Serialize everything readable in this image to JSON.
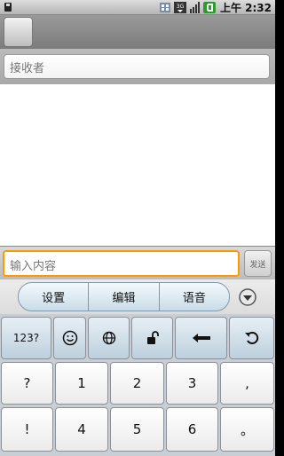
{
  "status_bar": {
    "time": "上午 2:32",
    "icons": [
      "sim-card-icon",
      "network-3g-icon",
      "signal-strength-icon",
      "battery-icon"
    ]
  },
  "recipients": {
    "placeholder": "接收者"
  },
  "compose": {
    "placeholder": "输入内容",
    "send_label": "发送"
  },
  "ime_toolbar": {
    "items": [
      "设置",
      "编辑",
      "语音"
    ],
    "more_icon": "chevron-down-circle-icon"
  },
  "keyboard": {
    "row1": {
      "mode_label": "123?",
      "keys": [
        "smiley-icon",
        "globe-icon",
        "unlock-icon",
        "backspace-arrow-icon",
        "undo-icon"
      ]
    },
    "row2": [
      "?",
      "1",
      "2",
      "3",
      ","
    ],
    "row3": [
      "!",
      "4",
      "5",
      "6",
      "。"
    ]
  }
}
